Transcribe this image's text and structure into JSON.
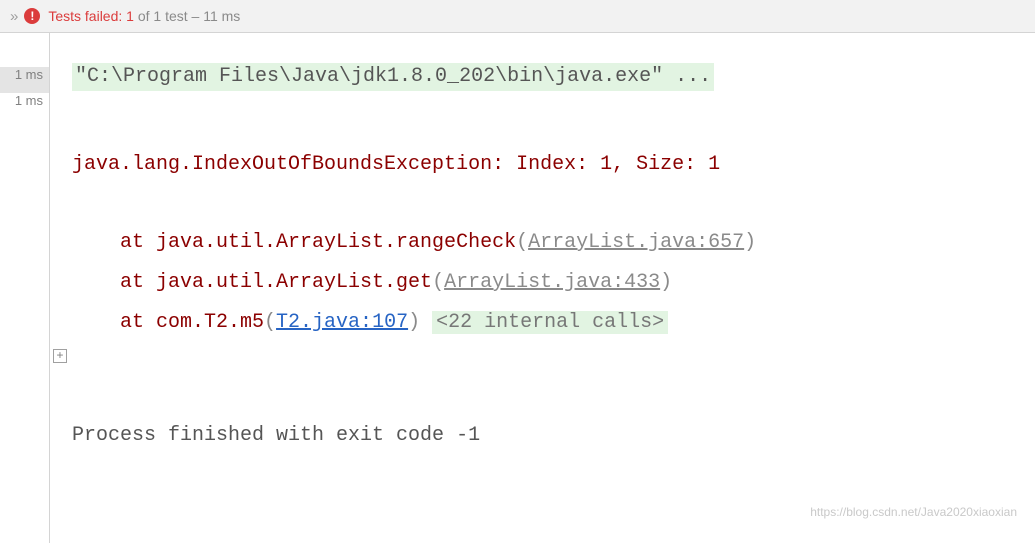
{
  "header": {
    "chevrons": "»",
    "fail_label": "Tests failed: 1",
    "of_label": " of 1 test – 11 ms"
  },
  "timings": [
    "1 ms",
    "1 ms"
  ],
  "console": {
    "command": "\"C:\\Program Files\\Java\\jdk1.8.0_202\\bin\\java.exe\" ...",
    "exception": "java.lang.IndexOutOfBoundsException: Index: 1, Size: 1",
    "stack": [
      {
        "prefix": "    at java.util.ArrayList.rangeCheck",
        "link": "ArrayList.java:657",
        "link_style": "grey"
      },
      {
        "prefix": "    at java.util.ArrayList.get",
        "link": "ArrayList.java:433",
        "link_style": "grey"
      },
      {
        "prefix": "    at com.T2.m5",
        "link": "T2.java:107",
        "link_style": "blue",
        "suffix": "<22 internal calls>"
      }
    ],
    "exit": "Process finished with exit code -1"
  },
  "gutter": {
    "plus": "+"
  },
  "watermark": "https://blog.csdn.net/Java2020xiaoxian"
}
